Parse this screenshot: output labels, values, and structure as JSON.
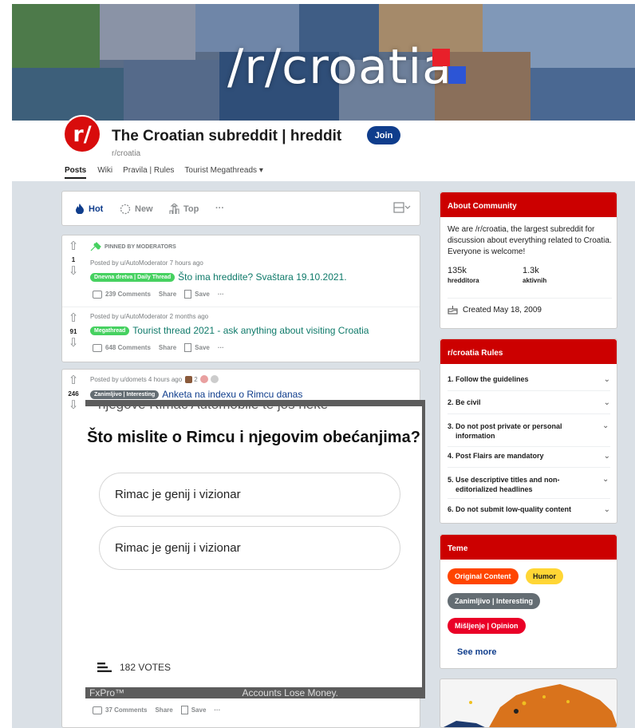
{
  "banner": {
    "title": "/r/croatia"
  },
  "header": {
    "logo_text": "r/",
    "title": "The Croatian subreddit | hreddit",
    "subreddit": "r/croatia",
    "join_label": "Join"
  },
  "nav": {
    "tabs": [
      "Posts",
      "Wiki",
      "Pravila | Rules",
      "Tourist Megathreads"
    ],
    "dropdown_icon": "▾"
  },
  "sort": {
    "hot": "Hot",
    "new": "New",
    "top": "Top",
    "more": "···",
    "layout_icon": "view-toggle-icon"
  },
  "pinned_label": "PINNED BY MODERATORS",
  "posts": [
    {
      "votes": "1",
      "meta": "Posted by u/AutoModerator 7 hours ago",
      "flair": "Dnevna dretva | Daily Thread",
      "flair_color": "#46d160",
      "title": "Što ima hreddite? Svaštara 19.10.2021.",
      "comments": "239 Comments",
      "share": "Share",
      "save": "Save",
      "more": "···"
    },
    {
      "votes": "91",
      "meta": "Posted by u/AutoModerator 2 months ago",
      "flair": "Megathread",
      "flair_color": "#46d160",
      "title": "Tourist thread 2021 - ask anything about visiting Croatia",
      "comments": "648 Comments",
      "share": "Share",
      "save": "Save",
      "more": "···"
    },
    {
      "votes": "246",
      "meta": "Posted by u/domets 4 hours ago",
      "award_count": "2",
      "flair": "Zanimljivo | Interesting",
      "flair_color": "#646d73",
      "title": "Anketa na indexu o Rimcu danas",
      "comments": "37 Comments",
      "share": "Share",
      "save": "Save",
      "more": "···"
    }
  ],
  "poll": {
    "cut_text_top": "njegove Rimac Automobile te još neke",
    "question": "Što mislite o Rimcu i njegovim obećanjima?",
    "options": [
      "Rimac je genij i vizionar",
      "Rimac je genij i vizionar"
    ],
    "votes": "182 VOTES",
    "bottom_ad": "FxPro™",
    "bottom_text": "Accounts Lose Money."
  },
  "about": {
    "header": "About Community",
    "description": "We are /r/croatia, the largest subreddit for discussion about everything related to Croatia. Everyone is welcome!",
    "members_value": "135k",
    "members_label": "hredditora",
    "online_value": "1.3k",
    "online_label": "aktivnih",
    "created": "Created May 18, 2009"
  },
  "rules": {
    "header": "r/croatia Rules",
    "items": [
      "1. Follow the guidelines",
      "2. Be civil",
      "3. Do not post private or personal information",
      "4. Post Flairs are mandatory",
      "5. Use descriptive titles and non-editorialized headlines",
      "6. Do not submit low-quality content"
    ]
  },
  "teme": {
    "header": "Teme",
    "tags": [
      {
        "label": "Original Content",
        "color": "#ff4500"
      },
      {
        "label": "Humor",
        "color": "#ffd635"
      },
      {
        "label": "Zanimljivo | Interesting",
        "color": "#646d73"
      },
      {
        "label": "Mišljenje | Opinion",
        "color": "#ea0027"
      }
    ],
    "see_more": "See more"
  },
  "colors": {
    "accent": "#cc0000",
    "brand_blue": "#0f3d8c",
    "feed_bg": "#dae0e6"
  }
}
